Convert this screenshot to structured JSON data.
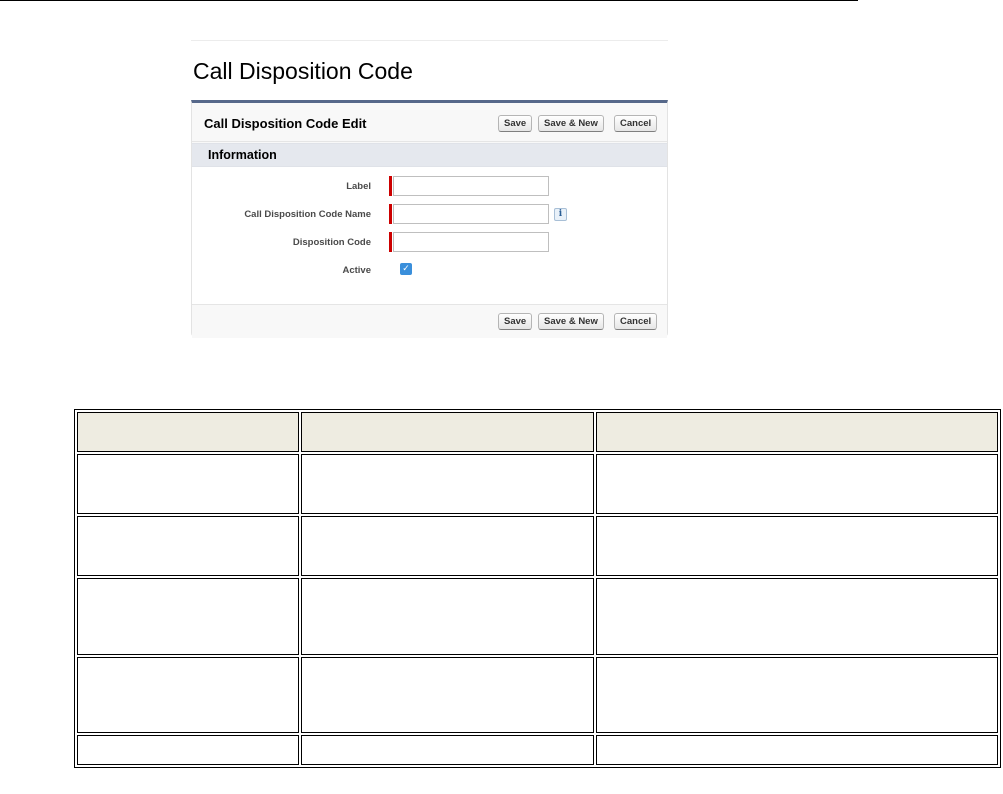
{
  "page_title": "Call Disposition Code",
  "panel": {
    "edit_title": "Call Disposition Code Edit",
    "buttons": {
      "save": "Save",
      "save_new": "Save & New",
      "cancel": "Cancel"
    },
    "section_title": "Information",
    "fields": [
      {
        "label": "Label",
        "value": "",
        "required": true
      },
      {
        "label": "Call Disposition Code Name",
        "value": "",
        "required": true,
        "help": "i"
      },
      {
        "label": "Disposition Code",
        "value": "",
        "required": true
      },
      {
        "label": "Active",
        "checked": true,
        "check_glyph": "✓"
      }
    ],
    "colors": {
      "accent": "#56688a",
      "required": "#cc0000",
      "checkbox": "#3a8fdb",
      "section": "#e5e8ee"
    }
  },
  "table": {
    "header_color": "#eeece1",
    "headers": [
      "",
      "",
      ""
    ],
    "rows": [
      [
        "",
        "",
        ""
      ],
      [
        "",
        "",
        ""
      ],
      [
        "",
        "",
        ""
      ],
      [
        "",
        "",
        ""
      ],
      [
        "",
        "",
        ""
      ]
    ]
  }
}
